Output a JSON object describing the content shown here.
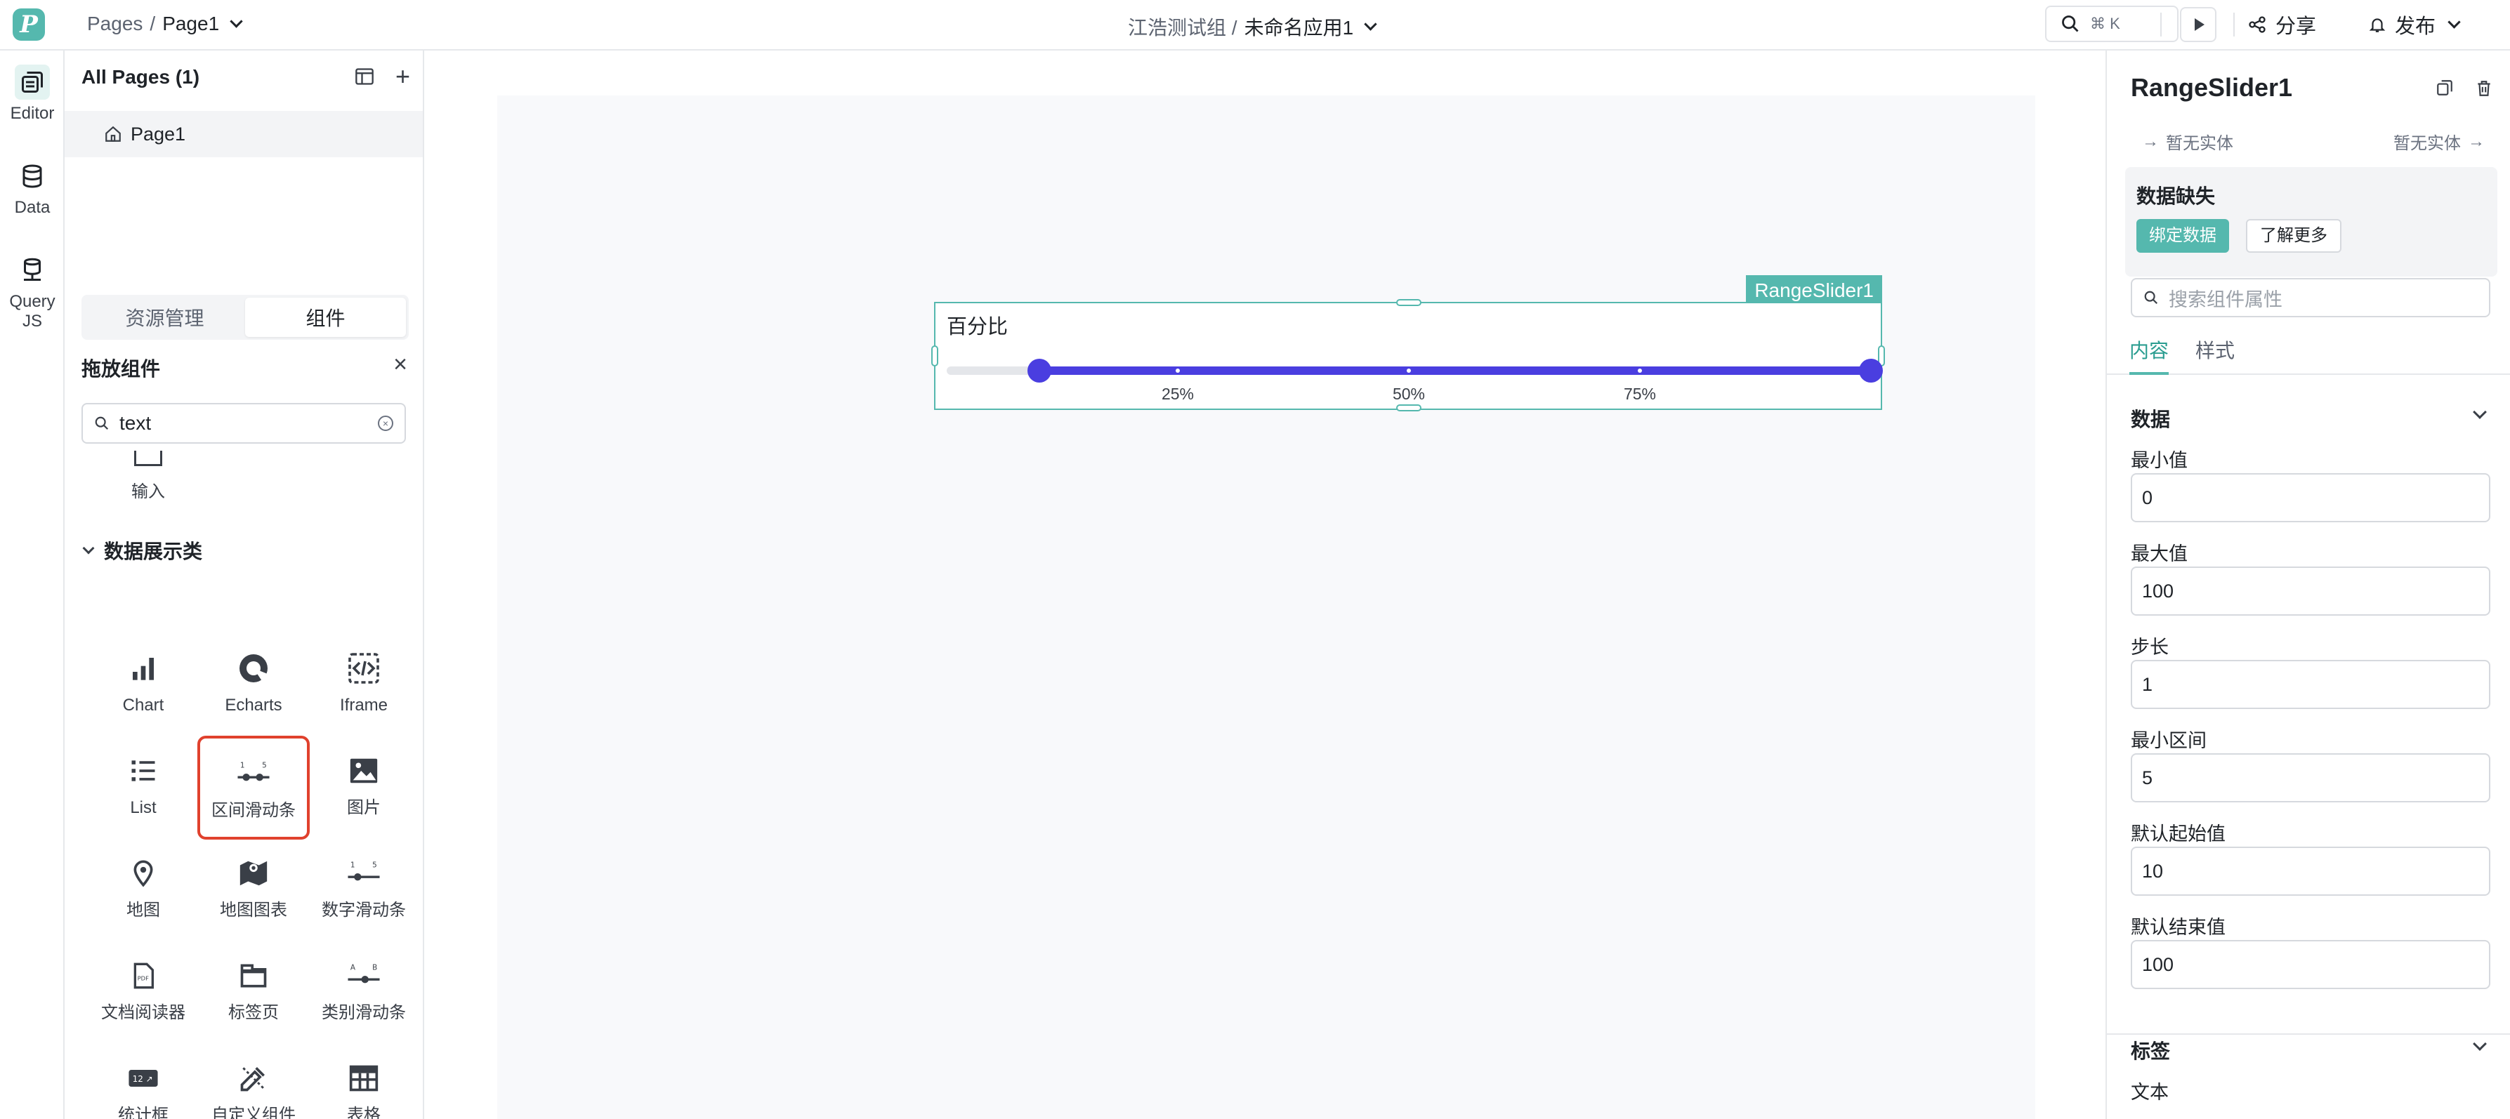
{
  "topbar": {
    "logo": "P",
    "breadcrumb_root": "Pages",
    "breadcrumb_sep": "/",
    "breadcrumb_page": "Page1",
    "group": "江浩测试组 /",
    "app_name": "未命名应用1",
    "shortcut": "⌘ K",
    "share": "分享",
    "publish": "发布"
  },
  "rail": {
    "editor": "Editor",
    "data": "Data",
    "query_line1": "Query",
    "query_line2": "JS"
  },
  "left_panel": {
    "title": "All Pages (1)",
    "page": "Page1",
    "tab_assets": "资源管理",
    "tab_components": "组件",
    "drag_title": "拖放组件",
    "search_value": "text",
    "input_item": "输入",
    "category": "数据展示类",
    "components": [
      {
        "label": "Chart",
        "icon": "bar-chart-icon"
      },
      {
        "label": "Echarts",
        "icon": "echarts-icon"
      },
      {
        "label": "Iframe",
        "icon": "iframe-icon"
      },
      {
        "label": "List",
        "icon": "list-icon"
      },
      {
        "label": "区间滑动条",
        "icon": "range-slider-icon",
        "selected": true
      },
      {
        "label": "图片",
        "icon": "image-icon"
      },
      {
        "label": "地图",
        "icon": "map-pin-icon"
      },
      {
        "label": "地图图表",
        "icon": "map-chart-icon"
      },
      {
        "label": "数字滑动条",
        "icon": "number-slider-icon"
      },
      {
        "label": "文档阅读器",
        "icon": "pdf-reader-icon"
      },
      {
        "label": "标签页",
        "icon": "tabs-icon"
      },
      {
        "label": "类别滑动条",
        "icon": "category-slider-icon"
      },
      {
        "label": "统计框",
        "icon": "statistic-icon"
      },
      {
        "label": "自定义组件\n(New)",
        "icon": "custom-component-icon"
      },
      {
        "label": "表格",
        "icon": "table-icon"
      }
    ]
  },
  "canvas": {
    "widget_tag": "RangeSlider1",
    "slider_label": "百分比",
    "slider": {
      "min": 0,
      "max": 100,
      "start": 10,
      "end": 100
    },
    "marks": [
      {
        "value": 25,
        "label": "25%"
      },
      {
        "value": 50,
        "label": "50%"
      },
      {
        "value": 75,
        "label": "75%"
      }
    ],
    "colors": {
      "accent": "#55b8ae",
      "slider": "#4a3ee0",
      "selected_border": "#e0412d"
    }
  },
  "right_panel": {
    "title": "RangeSlider1",
    "entity_left": "暂无实体",
    "entity_right": "暂无实体",
    "warning_title": "数据缺失",
    "bind_button": "绑定数据",
    "learn_button": "了解更多",
    "search_placeholder": "搜索组件属性",
    "tab_content": "内容",
    "tab_style": "样式",
    "section_data": "数据",
    "fields": [
      {
        "label": "最小值",
        "value": "0"
      },
      {
        "label": "最大值",
        "value": "100"
      },
      {
        "label": "步长",
        "value": "1"
      },
      {
        "label": "最小区间",
        "value": "5"
      },
      {
        "label": "默认起始值",
        "value": "10"
      },
      {
        "label": "默认结束值",
        "value": "100"
      }
    ],
    "section_label": "标签",
    "label_text": "文本"
  }
}
